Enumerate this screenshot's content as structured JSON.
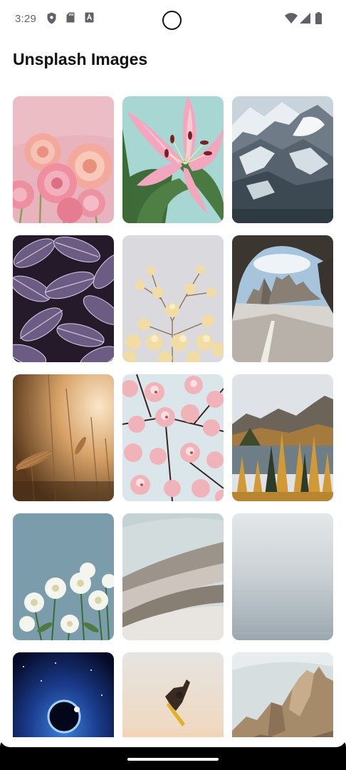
{
  "status_bar": {
    "time": "3:29",
    "left_icons": [
      "shield-icon",
      "sd-card-icon",
      "keyboard-a-icon"
    ],
    "right_icons": [
      "wifi-icon",
      "cellular-signal-icon",
      "battery-icon"
    ]
  },
  "header": {
    "title": "Unsplash Images"
  },
  "gallery": {
    "images": [
      {
        "subject": "pink-ranunculus-flowers"
      },
      {
        "subject": "pink-lily-flower"
      },
      {
        "subject": "snowy-mountain-range"
      },
      {
        "subject": "purple-striped-leaves"
      },
      {
        "subject": "pale-yellow-blossom-branches"
      },
      {
        "subject": "rock-arch-dolomite-peaks"
      },
      {
        "subject": "golden-wheat-field"
      },
      {
        "subject": "pink-cherry-blossoms"
      },
      {
        "subject": "autumn-larch-lake"
      },
      {
        "subject": "white-daisies-blue-sky"
      },
      {
        "subject": "abstract-silk-waves"
      },
      {
        "subject": "misty-calm-sea"
      },
      {
        "subject": "blue-nebula-eclipse"
      },
      {
        "subject": "snowboarder-jumping"
      },
      {
        "subject": "rocky-mountain-peaks"
      }
    ]
  },
  "colors": {
    "title_text": "#111111",
    "status_text": "#5f6368",
    "background": "#ffffff"
  }
}
